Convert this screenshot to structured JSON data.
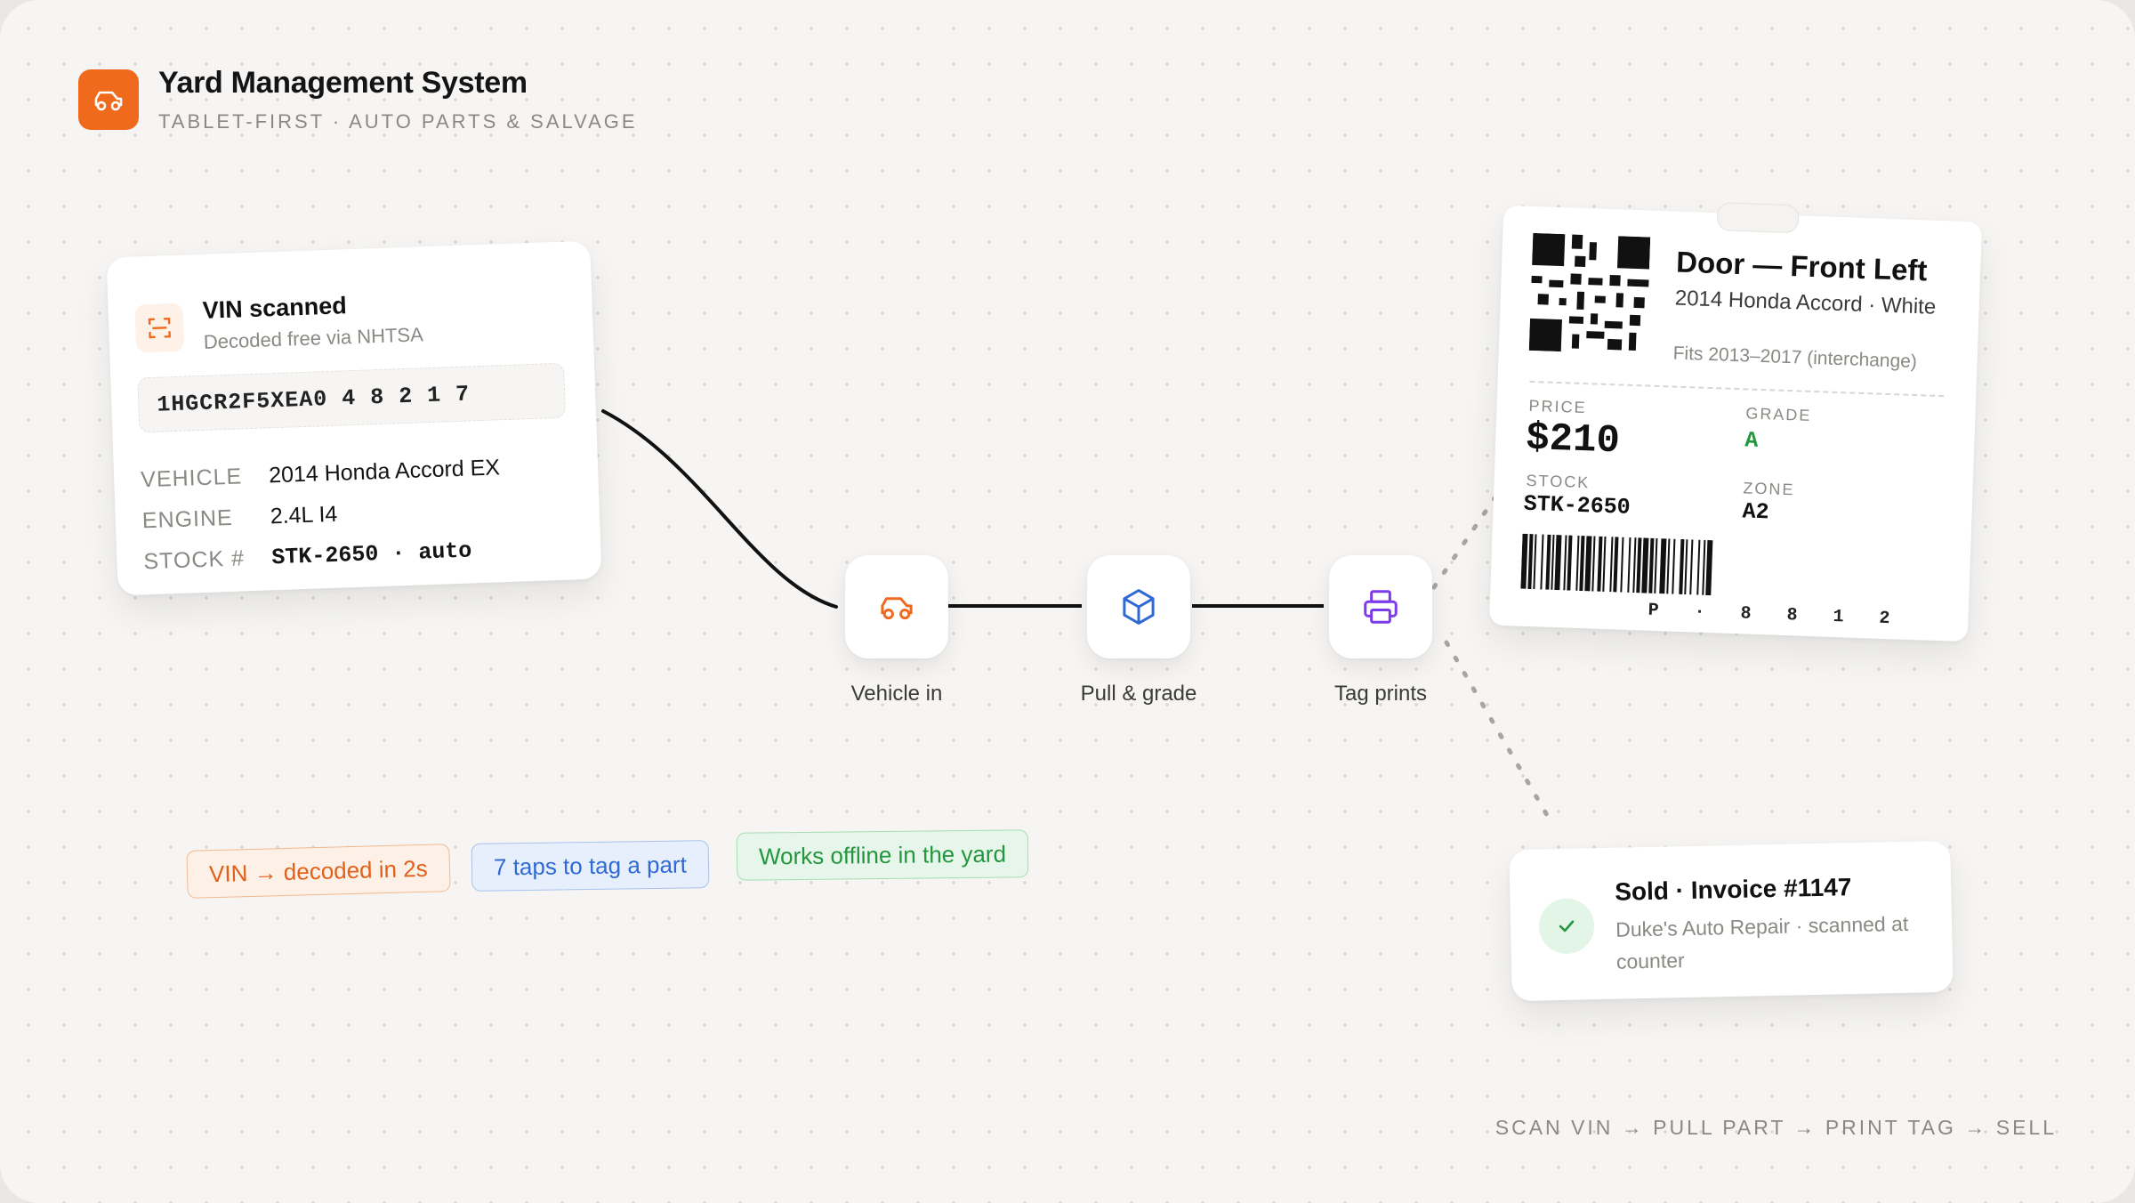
{
  "header": {
    "title": "Yard Management System",
    "subtitle": "TABLET-FIRST · AUTO PARTS & SALVAGE",
    "logo_icon": "car-icon",
    "brand_color": "#f06a1e"
  },
  "vin_card": {
    "icon": "scan-icon",
    "title": "VIN scanned",
    "subtitle": "Decoded free via NHTSA",
    "vin": "1HGCR2F5XEA0 4 8 2 1 7",
    "rows": [
      {
        "key": "VEHICLE",
        "value": "2014 Honda Accord EX"
      },
      {
        "key": "ENGINE",
        "value": "2.4L I4"
      },
      {
        "key": "STOCK #",
        "value": "STK-2650 · auto"
      }
    ]
  },
  "pipeline": {
    "steps": [
      {
        "label": "Vehicle in",
        "icon": "car-icon",
        "color": "#f06a1e"
      },
      {
        "label": "Pull & grade",
        "icon": "box-icon",
        "color": "#2f69d5"
      },
      {
        "label": "Tag prints",
        "icon": "printer-icon",
        "color": "#7c3aed"
      }
    ]
  },
  "pills": [
    {
      "text": "VIN → decoded in 2s",
      "color": "#e1611a"
    },
    {
      "text": "7 taps to tag a part",
      "color": "#2f69d5"
    },
    {
      "text": "Works offline in the yard",
      "color": "#23963e"
    }
  ],
  "tag": {
    "title": "Door — Front Left",
    "vehicle": "2014 Honda Accord · White",
    "fits": "Fits 2013–2017 (interchange)",
    "price_label": "PRICE",
    "price": "$210",
    "grade_label": "GRADE",
    "grade": "A",
    "grade_color": "#23963e",
    "stock_label": "STOCK",
    "stock": "STK-2650",
    "zone_label": "ZONE",
    "zone": "A2",
    "barcode_text": "P · 8 8 1 2"
  },
  "sold": {
    "icon": "check-icon",
    "title": "Sold · Invoice #1147",
    "subtitle": "Duke's Auto Repair · scanned at counter"
  },
  "footer": "SCAN VIN → PULL PART → PRINT TAG → SELL"
}
